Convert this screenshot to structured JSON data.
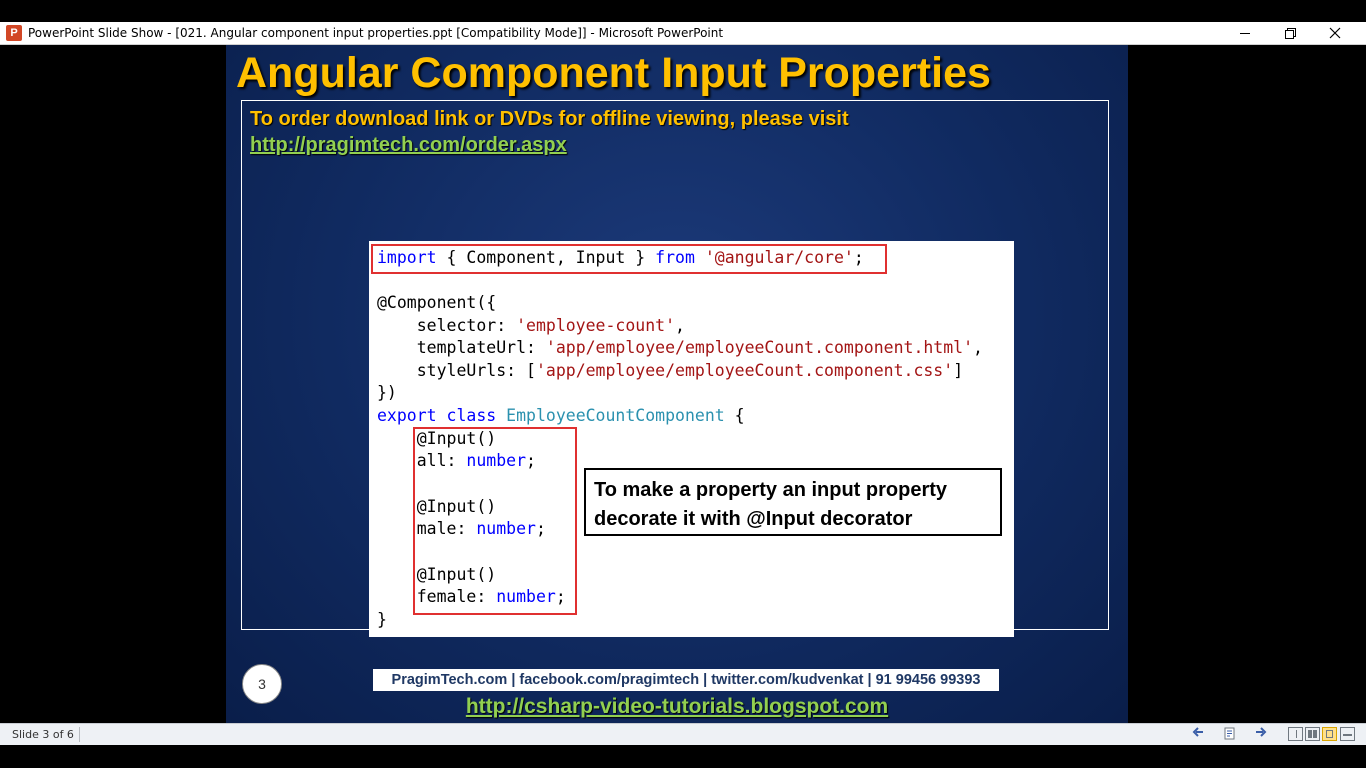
{
  "window": {
    "app_icon_letter": "P",
    "title": "PowerPoint Slide Show - [021. Angular component input properties.ppt [Compatibility Mode]] - Microsoft PowerPoint"
  },
  "slide": {
    "title": "Angular Component Input Properties",
    "order_text": "To order download link or DVDs for offline viewing, please visit",
    "order_link": "http://pragimtech.com/order.aspx",
    "code": {
      "l1_import": "import",
      "l1_mid": " { Component, Input } ",
      "l1_from": "from",
      "l1_space": " ",
      "l1_module": "'@angular/core'",
      "l1_end": ";",
      "l2": "@Component({",
      "l3_key": "    selector: ",
      "l3_val": "'employee-count'",
      "l3_end": ",",
      "l4_key": "    templateUrl: ",
      "l4_val": "'app/employee/employeeCount.component.html'",
      "l4_end": ",",
      "l5_key": "    styleUrls: [",
      "l5_val": "'app/employee/employeeCount.component.css'",
      "l5_end": "]",
      "l6": "})",
      "l7_export": "export",
      "l7_sp1": " ",
      "l7_class": "class",
      "l7_sp2": " ",
      "l7_name": "EmployeeCountComponent",
      "l7_end": " {",
      "l8": "    @Input()",
      "l9_key": "    all: ",
      "l9_type": "number",
      "l9_end": ";",
      "l10": "    @Input()",
      "l11_key": "    male: ",
      "l11_type": "number",
      "l11_end": ";",
      "l12": "    @Input()",
      "l13_key": "    female: ",
      "l13_type": "number",
      "l13_end": ";",
      "l14": "}"
    },
    "callout_line1": "To make a property an input property",
    "callout_line2": "decorate it with @Input decorator",
    "slide_number": "3",
    "footer": "PragimTech.com | facebook.com/pragimtech | twitter.com/kudvenkat | 91 99456 99393",
    "footer_link": "http://csharp-video-tutorials.blogspot.com"
  },
  "statusbar": {
    "slide_status": "Slide 3 of 6"
  },
  "colors": {
    "title": "#ffc000",
    "link": "#92d050",
    "slide_bg": "#102a60",
    "highlight_box": "#e03030",
    "keyword": "#0000ff",
    "string": "#a31515",
    "class_name": "#2b91af"
  },
  "icons": {
    "app": "powerpoint-icon",
    "prev": "previous-slide-icon",
    "notes": "notes-icon",
    "next": "next-slide-icon",
    "normal_view": "normal-view-icon",
    "sorter_view": "slide-sorter-view-icon",
    "reading_view": "reading-view-icon",
    "slideshow_view": "slideshow-view-icon"
  }
}
